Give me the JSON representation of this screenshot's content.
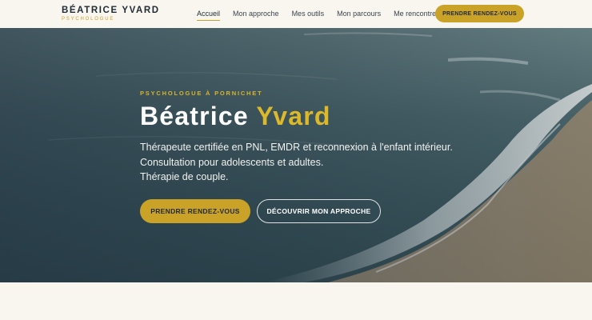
{
  "brand": {
    "name": "BÉATRICE YVARD",
    "subtitle": "PSYCHOLOGUE"
  },
  "nav": {
    "items": [
      {
        "label": "Accueil",
        "active": true
      },
      {
        "label": "Mon approche",
        "active": false
      },
      {
        "label": "Mes outils",
        "active": false
      },
      {
        "label": "Mon parcours",
        "active": false
      },
      {
        "label": "Me rencontrer",
        "active": false
      }
    ],
    "cta_label": "PRENDRE RENDEZ-VOUS"
  },
  "hero": {
    "kicker": "PSYCHOLOGUE À PORNICHET",
    "title_first": "Béatrice",
    "title_last": "Yvard",
    "lines": [
      "Thérapeute certifiée en PNL, EMDR et reconnexion à l'enfant intérieur.",
      "Consultation pour adolescents et adultes.",
      "Thérapie de couple."
    ],
    "primary_button": "PRENDRE RENDEZ-VOUS",
    "secondary_button": "DÉCOUVRIR MON APPROCHE"
  },
  "colors": {
    "accent": "#c9a227",
    "background": "#f8f6ef",
    "text_dark": "#1f2a33"
  }
}
